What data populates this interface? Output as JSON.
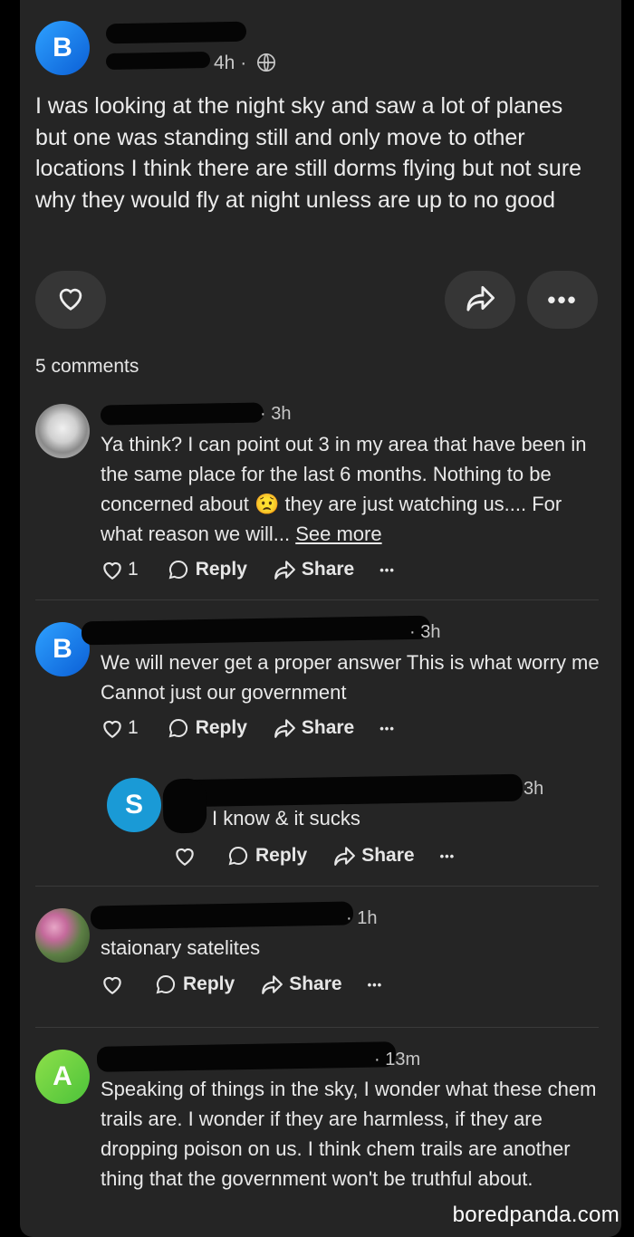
{
  "post": {
    "avatar_letter": "B",
    "time": "4h ·",
    "text": "I was looking at the night sky and saw a lot of planes but one was standing still and only move to other locations I think there are still dorms flying but not sure why they would fly at night unless are up to no good",
    "comments_count": "5 comments"
  },
  "comments": [
    {
      "time": "· 3h",
      "text": "Ya think? I can point out 3 in my area that have been in the same place for the last 6 months. Nothing to be concerned about",
      "text_after_emoji": " they are just watching us.... For what reason we will...",
      "see_more": "See more",
      "likes": "1",
      "reply": "Reply",
      "share": "Share"
    },
    {
      "avatar_letter": "B",
      "time": "· 3h",
      "text": "We will never get a proper answer This is what worry me Cannot just our government",
      "likes": "1",
      "reply": "Reply",
      "share": "Share"
    },
    {
      "avatar_letter": "S",
      "time": "3h",
      "text": "I know & it sucks",
      "reply": "Reply",
      "share": "Share"
    },
    {
      "time": "· 1h",
      "text": "staionary satelites",
      "reply": "Reply",
      "share": "Share"
    },
    {
      "avatar_letter": "A",
      "time": "· 13m",
      "text": "Speaking of things in the sky, I wonder what these chem trails are. I wonder if they are harmless, if they are dropping poison on us. I think chem trails are another thing that the government won't be truthful about."
    }
  ],
  "emoji": "😟",
  "watermark": "boredpanda.com",
  "colors": {
    "avatar_b": "#1877f2",
    "avatar_s": "#1a9ad6",
    "avatar_a": "#6dd33b",
    "card": "#252525"
  }
}
